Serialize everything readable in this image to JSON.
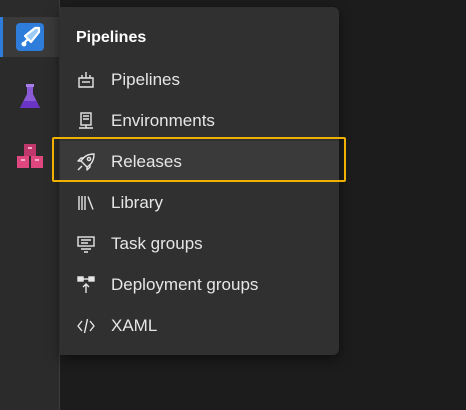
{
  "rail": {
    "items": [
      {
        "name": "pipelines-app-icon",
        "active": true
      },
      {
        "name": "test-plans-app-icon",
        "active": false
      },
      {
        "name": "artifacts-app-icon",
        "active": false
      }
    ]
  },
  "menu": {
    "title": "Pipelines",
    "items": [
      {
        "label": "Pipelines",
        "icon": "pipelines-icon"
      },
      {
        "label": "Environments",
        "icon": "environments-icon"
      },
      {
        "label": "Releases",
        "icon": "rocket-icon",
        "selected": true
      },
      {
        "label": "Library",
        "icon": "library-icon"
      },
      {
        "label": "Task groups",
        "icon": "task-groups-icon"
      },
      {
        "label": "Deployment groups",
        "icon": "deployment-groups-icon"
      },
      {
        "label": "XAML",
        "icon": "code-icon"
      }
    ]
  },
  "colors": {
    "accent": "#2f7ddb",
    "focus": "#f0b000",
    "menu_bg": "#303030",
    "rail_bg": "#2b2b2b"
  }
}
